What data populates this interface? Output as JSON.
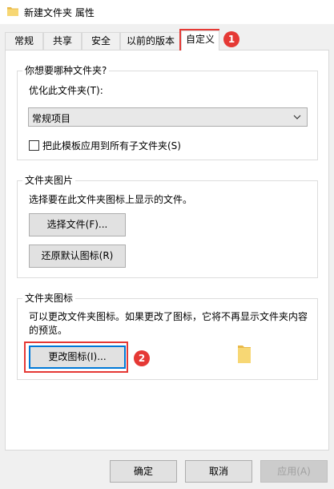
{
  "window": {
    "title": "新建文件夹 属性"
  },
  "tabs": [
    {
      "label": "常规"
    },
    {
      "label": "共享"
    },
    {
      "label": "安全"
    },
    {
      "label": "以前的版本"
    },
    {
      "label": "自定义",
      "active": true
    }
  ],
  "optimize_group": {
    "title": "你想要哪种文件夹?",
    "optimize_label": "优化此文件夹(T):",
    "select_value": "常规项目",
    "checkbox_label": "把此模板应用到所有子文件夹(S)",
    "checkbox_checked": false
  },
  "picture_group": {
    "title": "文件夹图片",
    "desc": "选择要在此文件夹图标上显示的文件。",
    "choose_button": "选择文件(F)...",
    "restore_button": "还原默认图标(R)"
  },
  "icon_group": {
    "title": "文件夹图标",
    "desc_line1": "可以更改文件夹图标。如果更改了图标，它将不再显示文件夹内容",
    "desc_line2": "的预览。",
    "change_button": "更改图标(I)..."
  },
  "footer": {
    "ok": "确定",
    "cancel": "取消",
    "apply": "应用(A)"
  },
  "annotations": [
    {
      "number": "1"
    },
    {
      "number": "2"
    }
  ],
  "colors": {
    "annotation": "#e53935",
    "focus_border": "#0078d7",
    "folder": "#f5c842"
  }
}
